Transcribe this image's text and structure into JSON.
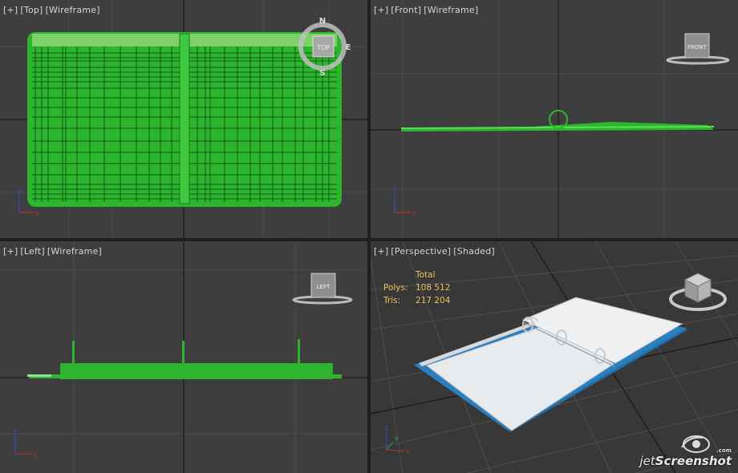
{
  "viewports": {
    "top": {
      "label_parts": [
        "[+]",
        "[Top]",
        "[Wireframe]"
      ],
      "viewcube": "TOP",
      "compass": {
        "n": "N",
        "e": "E",
        "s": "S"
      }
    },
    "front": {
      "label_parts": [
        "[+]",
        "[Front]",
        "[Wireframe]"
      ],
      "viewcube": "FRONT"
    },
    "left": {
      "label_parts": [
        "[+]",
        "[Left]",
        "[Wireframe]"
      ],
      "viewcube": "LEFT"
    },
    "perspective": {
      "label_parts": [
        "[+]",
        "[Perspective]",
        "[Shaded]"
      ],
      "stats": {
        "header": "Total",
        "polys_label": "Polys:",
        "polys_value": "108 512",
        "tris_label": "Tris:",
        "tris_value": "217 204"
      }
    }
  },
  "colors": {
    "wire": "#2db52d",
    "viewport_bg": "#3e3e3e",
    "active_border": "#b8a040",
    "stats": "#e8c25a",
    "binder_blue": "#1f6fa8"
  },
  "watermark": {
    "prefix": "jet",
    "brand": "Screenshot",
    "domain": ".com"
  }
}
